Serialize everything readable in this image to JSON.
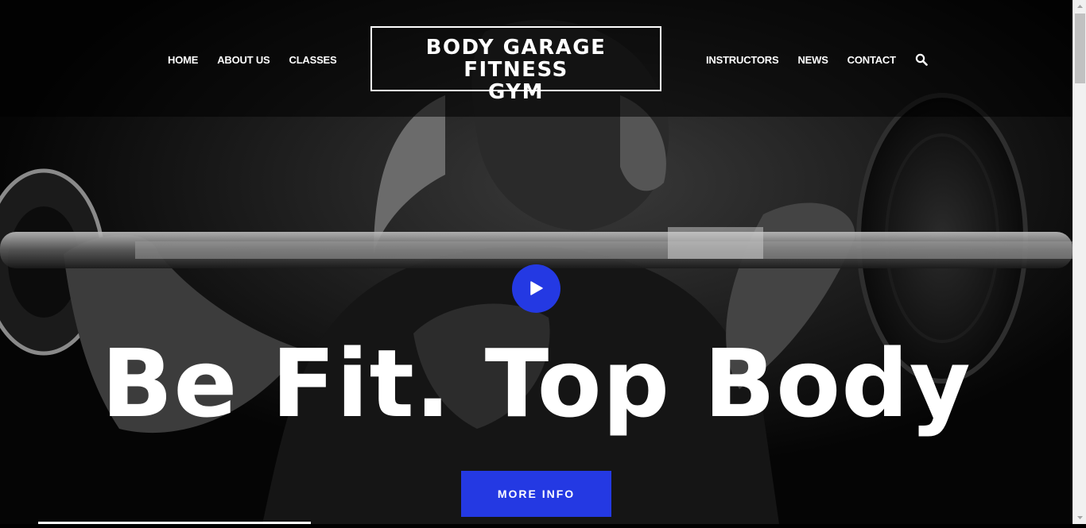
{
  "nav": {
    "left": [
      {
        "label": "HOME"
      },
      {
        "label": "ABOUT US"
      },
      {
        "label": "CLASSES"
      }
    ],
    "right": [
      {
        "label": "INSTRUCTORS"
      },
      {
        "label": "NEWS"
      },
      {
        "label": "CONTACT"
      }
    ],
    "search_icon": "search-icon"
  },
  "logo": {
    "line1": "BODY GARAGE FITNESS",
    "line2": "GYM"
  },
  "hero": {
    "headline": "Be Fit. Top Body",
    "play_icon": "play-icon",
    "cta_label": "MORE INFO"
  },
  "colors": {
    "accent": "#2439e3",
    "text": "#ffffff",
    "background": "#000000"
  }
}
